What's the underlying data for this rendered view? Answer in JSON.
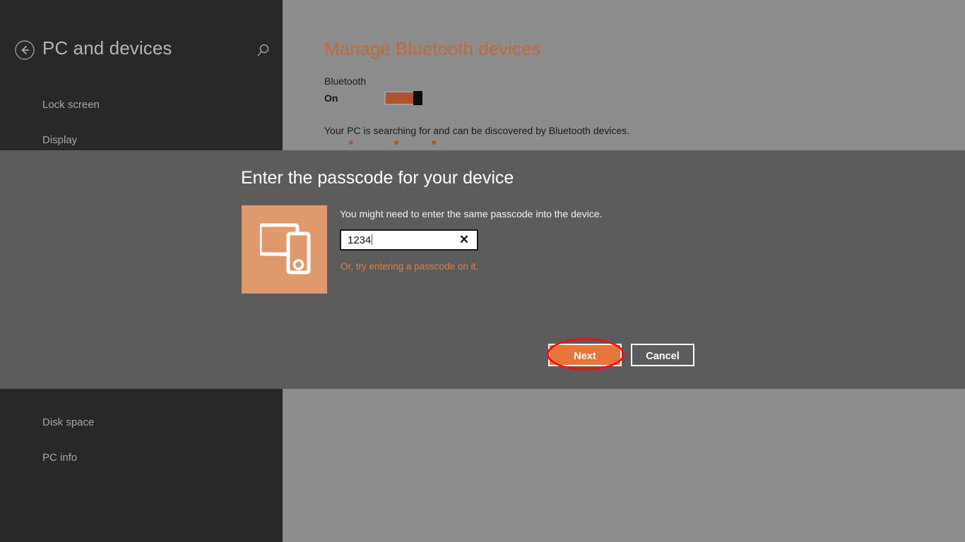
{
  "sidebar": {
    "back_icon": "back-arrow-icon",
    "title": "PC and devices",
    "search_icon": "search-icon",
    "items_top": [
      {
        "label": "Lock screen"
      },
      {
        "label": "Display"
      }
    ],
    "items_bottom": [
      {
        "label": "Disk space"
      },
      {
        "label": "PC info"
      }
    ]
  },
  "content": {
    "title": "Manage Bluetooth devices",
    "bluetooth_label": "Bluetooth",
    "toggle_state": "On",
    "searching_text": "Your PC is searching for and can be discovered by Bluetooth devices.",
    "progress_dots": 3
  },
  "dialog": {
    "title": "Enter the passcode for your device",
    "device_icon": "pc-and-phone-icon",
    "description": "You might need to enter the same passcode into the device.",
    "passcode_value": "1234",
    "passcode_placeholder": "",
    "clear_icon": "close-x-icon",
    "alt_link": "Or, try entering a passcode on it.",
    "next_label": "Next",
    "cancel_label": "Cancel"
  },
  "annotation": {
    "shape": "ellipse-highlight",
    "target": "Next",
    "color": "#ee1111"
  },
  "colors": {
    "sidebar_bg": "#282828",
    "content_bg": "#8c8c8c",
    "dialog_bg": "#5c5c5c",
    "accent_orange": "#e8763a",
    "title_orange": "#c1693c",
    "tile_orange": "#e0996c",
    "link_orange": "#d77f4a"
  }
}
